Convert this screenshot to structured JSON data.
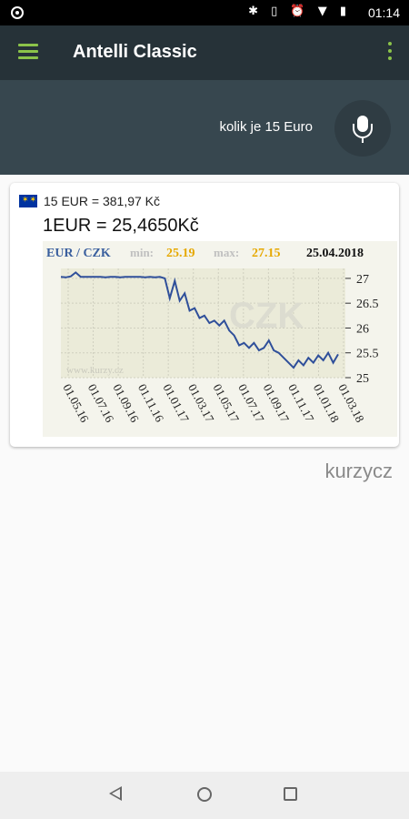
{
  "status_bar": {
    "time": "01:14",
    "icons": "✱ ▯ ⏰ ▼ ▮"
  },
  "app_bar": {
    "title": "Antelli Classic"
  },
  "query": {
    "text": "kolik je 15 Euro"
  },
  "result": {
    "conversion": "15 EUR = 381,97 Kč",
    "rate": "1EUR = 25,4650Kč"
  },
  "chart_meta": {
    "pair": "EUR / CZK",
    "min_label": "min:",
    "min_value": "25.19",
    "max_label": "max:",
    "max_value": "27.15",
    "date": "25.04.2018",
    "watermark_text": "CZK",
    "watermark_url": "www.kurzy.cz",
    "min_color": "#e6a800",
    "pair_color": "#3a5f9e"
  },
  "chart_data": {
    "type": "line",
    "title": "EUR / CZK",
    "ylim": [
      25,
      27.2
    ],
    "y_ticks": [
      "27",
      "26.5",
      "26",
      "25.5",
      "25"
    ],
    "x_ticks": [
      "01.05.16",
      "01.07.16",
      "01.09.16",
      "01.11.16",
      "01.01.17",
      "01.03.17",
      "01.05.17",
      "01.07.17",
      "01.09.17",
      "01.11.17",
      "01.01.18",
      "01.03.18"
    ],
    "series": [
      {
        "values": [
          27.03,
          27.02,
          27.04,
          27.12,
          27.03,
          27.03,
          27.03,
          27.03,
          27.03,
          27.02,
          27.03,
          27.03,
          27.02,
          27.03,
          27.03,
          27.03,
          27.03,
          27.02,
          27.03,
          27.02,
          27.03,
          27.0,
          26.6,
          26.95,
          26.55,
          26.7,
          26.35,
          26.4,
          26.2,
          26.25,
          26.1,
          26.15,
          26.05,
          26.15,
          25.95,
          25.85,
          25.65,
          25.7,
          25.6,
          25.7,
          25.55,
          25.6,
          25.75,
          25.55,
          25.5,
          25.4,
          25.3,
          25.2,
          25.35,
          25.25,
          25.4,
          25.3,
          25.45,
          25.35,
          25.5,
          25.3,
          25.47
        ]
      }
    ]
  },
  "brand": "kurzycz"
}
